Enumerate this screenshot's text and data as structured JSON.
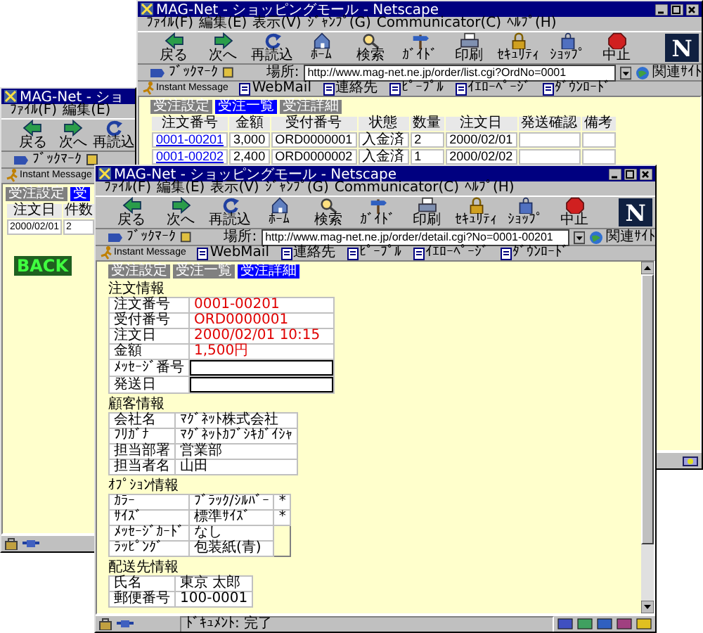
{
  "windows": [
    {
      "kind": "list",
      "title": "MAG-Net - ショッピングモール - Netscape",
      "menu": [
        "ﾌｧｲﾙ(F)",
        "編集(E)",
        "表示(V)",
        "ｼﾞｬﾝﾌﾟ(G)",
        "Communicator(C)",
        "ﾍﾙﾌﾟ(H)"
      ],
      "toolbar": [
        "戻る",
        "次へ",
        "再読込",
        "ﾎｰﾑ",
        "検索",
        "ｶﾞｲﾄﾞ",
        "印刷",
        "ｾｷｭﾘﾃｨ",
        "ｼｮｯﾌﾟ",
        "中止"
      ],
      "logo": "N",
      "bookmarks": "ﾌﾞｯｸﾏｰｸ",
      "location_label": "場所:",
      "url": "http://www.mag-net.ne.jp/order/list.cgi?OrdNo=0001",
      "related": "関連ｻｲﾄ",
      "personal": [
        "Instant Message",
        "WebMail",
        "連絡先",
        "ﾋﾟｰﾌﾟﾙ",
        "ｲｴﾛｰﾍﾟｰｼﾞ",
        "ﾀﾞｳﾝﾛｰﾄﾞ"
      ],
      "tabs": [
        {
          "label": "受注設定",
          "selected": false
        },
        {
          "label": "受注一覧",
          "selected": true
        },
        {
          "label": "受注詳細",
          "selected": false
        }
      ],
      "table": {
        "columns": [
          "注文番号",
          "金額",
          "受付番号",
          "状態",
          "数量",
          "注文日",
          "発送確認",
          "備考"
        ],
        "rows": [
          [
            "0001-00201",
            "3,000",
            "ORD0000001",
            "入金済",
            "2",
            "2000/02/01"
          ],
          [
            "0001-00202",
            "2,400",
            "ORD0000002",
            "入金済",
            "1",
            "2000/02/02"
          ]
        ]
      }
    },
    {
      "kind": "summary",
      "title": "MAG-Net - ショ",
      "menu": [
        "ﾌｧｲﾙ(F)",
        "編集(E)"
      ],
      "toolbar": [
        "戻る",
        "次へ",
        "再読込"
      ],
      "bookmarks": "ﾌﾞｯｸﾏｰｸ",
      "personal": [
        "Instant Message"
      ],
      "tabs": [
        {
          "label": "受注設定",
          "selected": false
        },
        {
          "label": "受",
          "selected": true
        }
      ],
      "table": {
        "columns": [
          "注文日",
          "件数"
        ],
        "rows": [
          [
            "2000/02/01",
            "2"
          ]
        ]
      },
      "back_button": "BACK"
    },
    {
      "kind": "detail",
      "title": "MAG-Net - ショッピングモール - Netscape",
      "menu": [
        "ﾌｧｲﾙ(F)",
        "編集(E)",
        "表示(V)",
        "ｼﾞｬﾝﾌﾟ(G)",
        "Communicator(C)",
        "ﾍﾙﾌﾟ(H)"
      ],
      "toolbar": [
        "戻る",
        "次へ",
        "再読込",
        "ﾎｰﾑ",
        "検索",
        "ｶﾞｲﾄﾞ",
        "印刷",
        "ｾｷｭﾘﾃｨ",
        "ｼｮｯﾌﾟ",
        "中止"
      ],
      "logo": "N",
      "bookmarks": "ﾌﾞｯｸﾏｰｸ",
      "location_label": "場所:",
      "url": "http://www.mag-net.ne.jp/order/detail.cgi?No=0001-00201",
      "related": "関連ｻｲﾄ",
      "personal": [
        "Instant Message",
        "WebMail",
        "連絡先",
        "ﾋﾟｰﾌﾟﾙ",
        "ｲｴﾛｰﾍﾟｰｼﾞ",
        "ﾀﾞｳﾝﾛｰﾄﾞ"
      ],
      "tabs": [
        {
          "label": "受注設定",
          "selected": false
        },
        {
          "label": "受注一覧",
          "selected": false
        },
        {
          "label": "受注詳細",
          "selected": true
        }
      ],
      "sections": [
        {
          "heading": "注文情報",
          "emphasis": true,
          "rows": [
            {
              "kind": "text",
              "cells": [
                "注文番号",
                "0001-00201"
              ]
            },
            {
              "kind": "text",
              "cells": [
                "受付番号",
                "ORD0000001"
              ]
            },
            {
              "kind": "text",
              "cells": [
                "注文日",
                "2000/02/01 10:15"
              ]
            },
            {
              "kind": "text",
              "cells": [
                "金額",
                "1,500円"
              ]
            },
            {
              "kind": "input",
              "cells": [
                "ﾒｯｾｰｼﾞ番号"
              ]
            },
            {
              "kind": "input",
              "cells": [
                "発送日"
              ]
            }
          ]
        },
        {
          "heading": "顧客情報",
          "emphasis": false,
          "rows": [
            {
              "kind": "text",
              "cells": [
                "会社名",
                "ﾏｸﾞﾈｯﾄ株式会社"
              ]
            },
            {
              "kind": "text",
              "cells": [
                "ﾌﾘｶﾞﾅ",
                "ﾏｸﾞﾈｯﾄｶﾌﾞｼｷｶﾞｲｼｬ"
              ]
            },
            {
              "kind": "text",
              "cells": [
                "担当部署",
                "営業部"
              ]
            },
            {
              "kind": "text",
              "cells": [
                "担当者名",
                "山田"
              ]
            }
          ]
        },
        {
          "heading": "ｵﾌﾟｼｮﾝ情報",
          "emphasis": false,
          "rows": [
            {
              "kind": "text",
              "cells": [
                "ｶﾗｰ",
                "ﾌﾞﾗｯｸ/ｼﾙﾊﾞｰ",
                "*"
              ]
            },
            {
              "kind": "text",
              "cells": [
                "ｻｲｽﾞ",
                "標準ｻｲｽﾞ",
                "*"
              ]
            },
            {
              "kind": "text",
              "cells": [
                "ﾒｯｾｰｼﾞｶｰﾄﾞ",
                "なし"
              ]
            },
            {
              "kind": "text",
              "cells": [
                "ﾗｯﾋﾟﾝｸﾞ",
                "包装紙(青)"
              ]
            }
          ]
        },
        {
          "heading": "配送先情報",
          "emphasis": false,
          "rows": [
            {
              "kind": "text",
              "cells": [
                "氏名",
                "東京 太郎"
              ]
            },
            {
              "kind": "text",
              "cells": [
                "郵便番号",
                "100-0001"
              ]
            }
          ]
        }
      ],
      "status": "ﾄﾞｷｭﾒﾝﾄ: 完了"
    }
  ]
}
